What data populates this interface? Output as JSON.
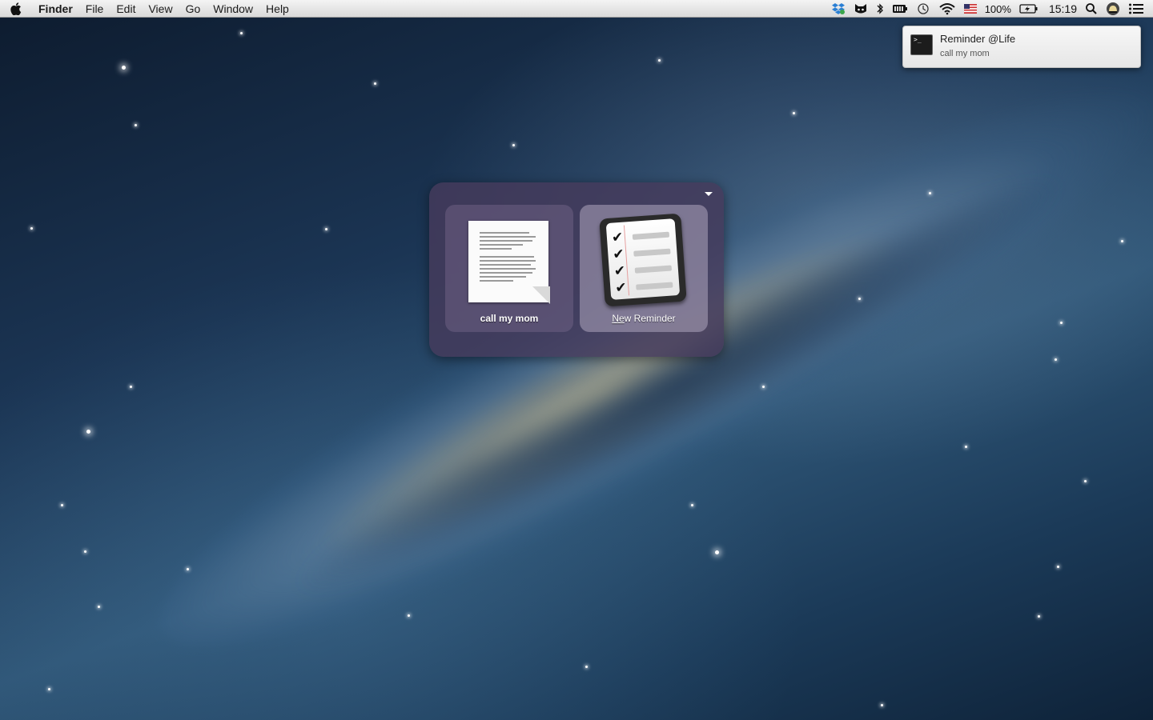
{
  "menubar": {
    "apple_icon": "apple-icon",
    "app_name": "Finder",
    "menus": [
      "File",
      "Edit",
      "View",
      "Go",
      "Window",
      "Help"
    ],
    "tray": {
      "icons": [
        "dropbox-icon",
        "cat-icon",
        "bluetooth-icon",
        "battery-meter-icon",
        "time-machine-icon",
        "wifi-icon",
        "us-flag-icon"
      ],
      "battery_percent": "100%",
      "clock": "15:19"
    }
  },
  "notification": {
    "title": "Reminder @Life",
    "body": "call my mom",
    "icon": "terminal-icon"
  },
  "launcher": {
    "tiles": [
      {
        "label": "call my mom",
        "icon": "document-icon"
      },
      {
        "label_mnemonic": "Ne",
        "label_rest": "w Reminder",
        "icon": "reminders-icon"
      }
    ]
  }
}
